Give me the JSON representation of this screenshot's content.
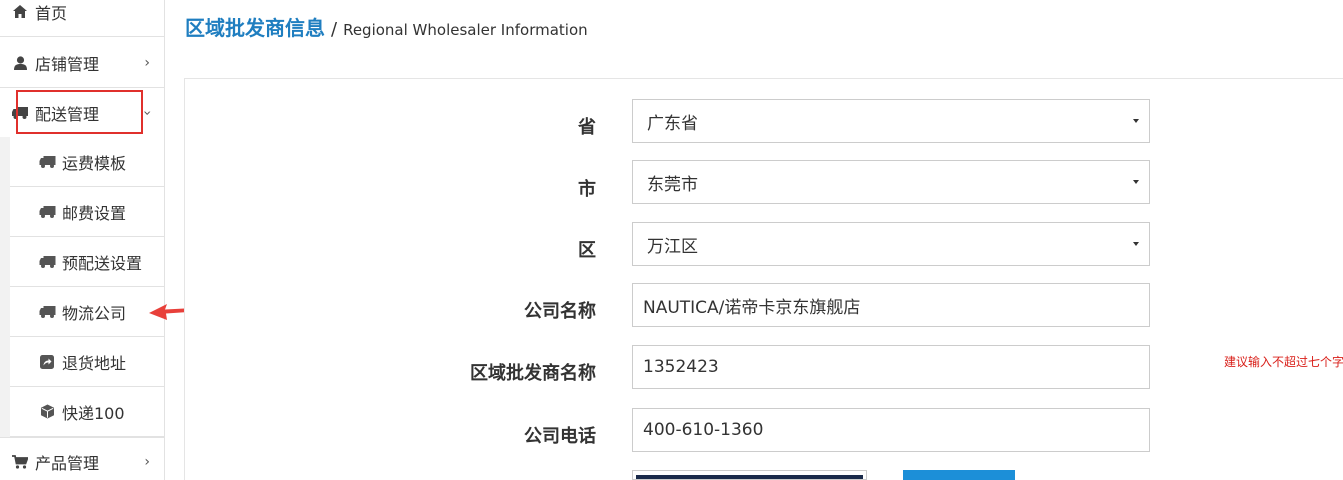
{
  "sidebar": {
    "items": [
      {
        "label": "首页",
        "icon": "home-icon"
      },
      {
        "label": "店铺管理",
        "icon": "user-icon",
        "chevron": "›"
      },
      {
        "label": "配送管理",
        "icon": "truck-icon",
        "chevron": "›"
      }
    ],
    "sub_items": [
      {
        "label": "运费模板",
        "icon": "truck-icon"
      },
      {
        "label": "邮费设置",
        "icon": "truck-icon"
      },
      {
        "label": "预配送设置",
        "icon": "truck-icon"
      },
      {
        "label": "物流公司",
        "icon": "truck-icon"
      },
      {
        "label": "退货地址",
        "icon": "share-icon"
      },
      {
        "label": "快递100",
        "icon": "cube-icon"
      }
    ],
    "bottom_item": {
      "label": "产品管理",
      "icon": "cart-icon",
      "chevron": "›"
    }
  },
  "header": {
    "title": "区域批发商信息",
    "separator": "/",
    "subtitle": "Regional Wholesaler Information"
  },
  "form": {
    "province": {
      "label": "省",
      "value": "广东省"
    },
    "city": {
      "label": "市",
      "value": "东莞市"
    },
    "district": {
      "label": "区",
      "value": "万江区"
    },
    "company_name": {
      "label": "公司名称",
      "value": "NAUTICA/诺帝卡京东旗舰店"
    },
    "wholesaler_name": {
      "label": "区域批发商名称",
      "value": "1352423",
      "hint": "建议输入不超过七个字"
    },
    "company_phone": {
      "label": "公司电话",
      "value": "400-610-1360"
    }
  },
  "colors": {
    "accent": "#1f7ec0",
    "highlight_box": "#e0302c",
    "arrow": "#e8403a",
    "hint": "#d9201a",
    "button": "#1c8fd8"
  }
}
